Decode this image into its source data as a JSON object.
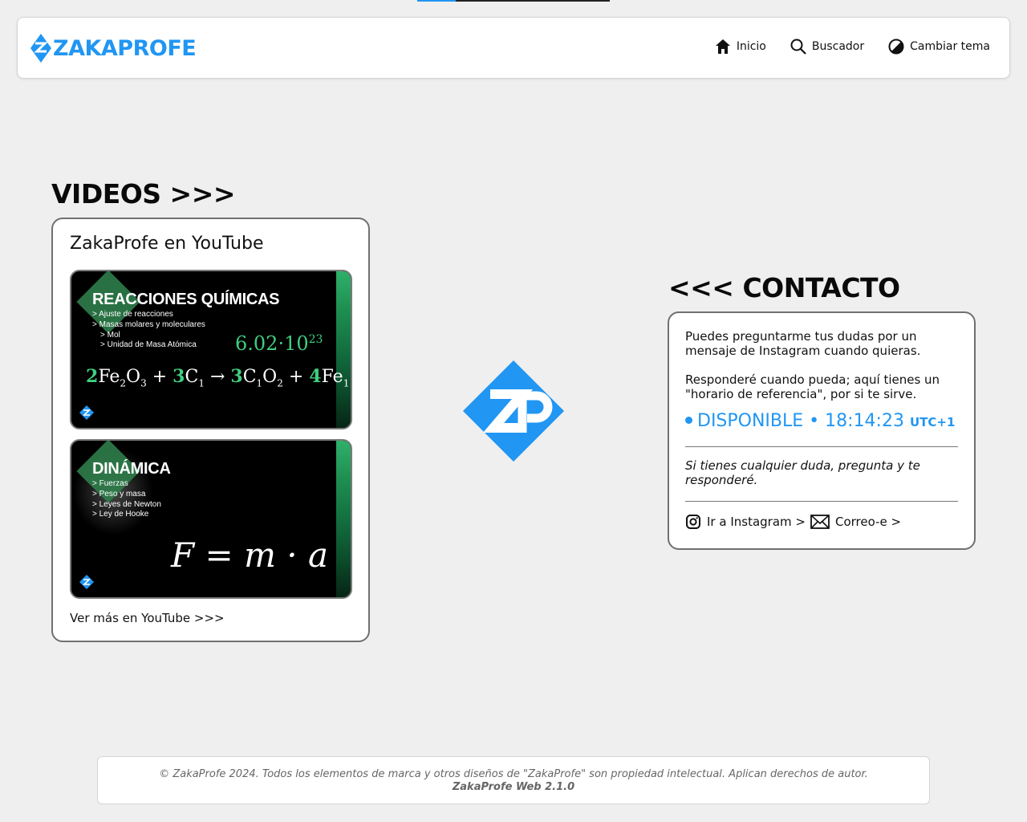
{
  "loading_progress": 0.2,
  "header": {
    "logo_text": "ZAKAPROFE",
    "nav": [
      {
        "label": "Inicio",
        "icon": "home-icon"
      },
      {
        "label": "Buscador",
        "icon": "search-icon"
      },
      {
        "label": "Cambiar tema",
        "icon": "theme-icon"
      }
    ]
  },
  "videos": {
    "heading": "VIDEOS >>>",
    "card_title": "ZakaProfe en YouTube",
    "video1": {
      "title": "REACCIONES QUÍMICAS",
      "lines": [
        "> Ajuste de reacciones",
        "> Masas molares y moleculares",
        "> Mol",
        "> Unidad de Masa Atómica"
      ],
      "constant_base": "6.02·10",
      "constant_exp": "23",
      "equation": {
        "c1": "2",
        "t1": "Fe",
        "s1": "2",
        "t2": "O",
        "s2": "3",
        "plus1": " + ",
        "c2": "3",
        "t3": "C",
        "s3": "1",
        "arrow": " → ",
        "c3": "3",
        "t4": "C",
        "s4": "1",
        "t5": "O",
        "s5": "2",
        "plus2": " + ",
        "c4": "4",
        "t6": "Fe",
        "s6": "1"
      }
    },
    "video2": {
      "title": "DINÁMICA",
      "lines": [
        "> Fuerzas",
        "> Peso y masa",
        "> Leyes de Newton",
        "> Ley de Hooke"
      ],
      "formula": "F = m · a"
    },
    "more_link": "Ver más en YouTube >>>"
  },
  "contact": {
    "heading": "<<< CONTACTO",
    "text1": "Puedes preguntarme tus dudas por un mensaje de Instagram cuando quieras.",
    "text2": "Responderé cuando pueda; aquí tienes un \"horario de referencia\", por si te sirve.",
    "status_label": "DISPONIBLE",
    "status_separator": "•",
    "time": "18:14:23",
    "timezone": "UTC+1",
    "note": "Si tienes cualquier duda, pregunta y te responderé.",
    "instagram_link": "Ir a Instagram >",
    "email_link": "Correo-e >"
  },
  "footer": {
    "copyright": "© ZakaProfe 2024. Todos los elementos de marca y otros diseños de \"ZakaProfe\" son propiedad intelectual. Aplican derechos de autor.",
    "version": "ZakaProfe Web 2.1.0"
  },
  "colors": {
    "accent": "#2196f3",
    "green_accent": "#3fcf7f",
    "background": "#efefef"
  }
}
